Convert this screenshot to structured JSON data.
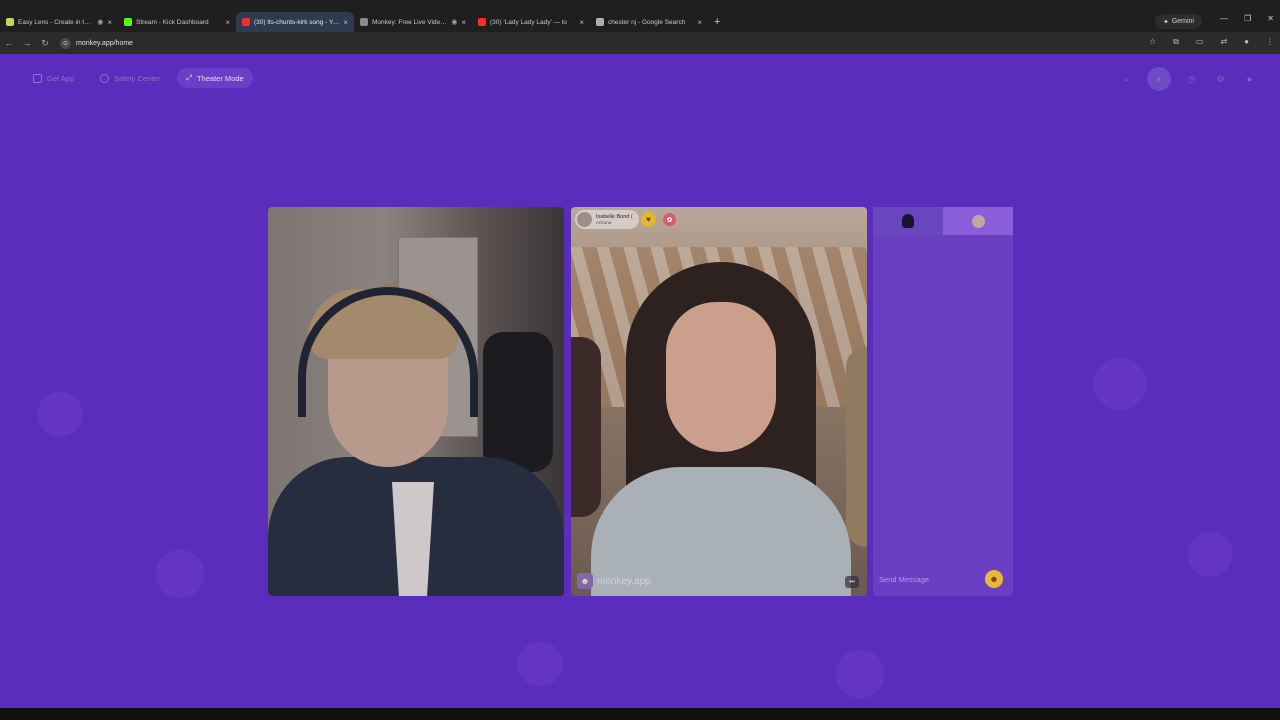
{
  "browser": {
    "tabs": [
      {
        "title": "Easy Lens - Create in the m",
        "favicon_color": "#c8d35a",
        "audio": true,
        "active": false
      },
      {
        "title": "Stream - Kick Dashboard",
        "favicon_color": "#53fc18",
        "audio": false,
        "active": false
      },
      {
        "title": "(30) lts-chunts-kirk song - YouT",
        "favicon_color": "#ff2a2a",
        "audio": false,
        "active": true
      },
      {
        "title": "Monkey: Free Live Video Ch",
        "favicon_color": "#8a8a8a",
        "audio": true,
        "active": false
      },
      {
        "title": "(30) 'Lady Lady Lady' — lo",
        "favicon_color": "#ff2a2a",
        "audio": false,
        "active": false
      },
      {
        "title": "chester nj - Google Search",
        "favicon_color": "#b0b0b0",
        "audio": false,
        "active": false
      }
    ],
    "new_tab_label": "+",
    "gemini_label": "Gemini",
    "url": "monkey.app/home"
  },
  "nav": {
    "get_app": "Get App",
    "safety_center": "Safety Center",
    "theater_mode": "Theater Mode"
  },
  "remote": {
    "name": "Isabelle Bond (",
    "location": "Arizona",
    "watermark": "monkey.app"
  },
  "chat": {
    "placeholder": "Send Message"
  },
  "colors": {
    "page_bg": "#5b2dbd",
    "accent_gold": "#e6b83a"
  }
}
